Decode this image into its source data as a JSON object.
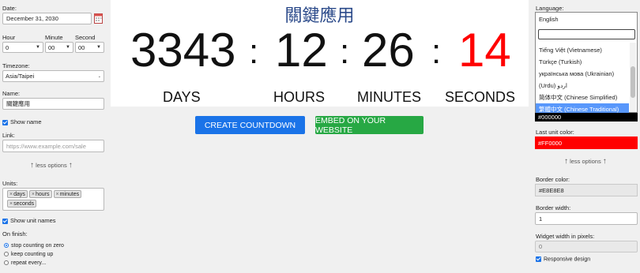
{
  "left": {
    "date_label": "Date:",
    "date_value": "December 31, 2030",
    "hour_label": "Hour",
    "hour_value": "0",
    "minute_label": "Minute",
    "minute_value": "00",
    "second_label": "Second",
    "second_value": "00",
    "timezone_label": "Timezone:",
    "timezone_value": "Asia/Taipei",
    "name_label": "Name:",
    "name_value": "關鍵應用",
    "show_name_label": "Show name",
    "link_label": "Link:",
    "link_placeholder": "https://www.example.com/sale",
    "less_options": "less options",
    "units_label": "Units:",
    "unit_tags": [
      "days",
      "hours",
      "minutes",
      "seconds"
    ],
    "show_unit_names_label": "Show unit names",
    "on_finish_label": "On finish:",
    "finish_options": [
      "stop counting on zero",
      "keep counting up",
      "repeat every..."
    ]
  },
  "center": {
    "title": "關鍵應用",
    "days": "3343",
    "hours": "12",
    "minutes": "26",
    "seconds": "14",
    "sep": ":",
    "days_label": "DAYS",
    "hours_label": "HOURS",
    "minutes_label": "MINUTES",
    "seconds_label": "SECONDS",
    "create_button": "CREATE COUNTDOWN",
    "embed_button": "EMBED ON YOUR WEBSITE"
  },
  "right": {
    "language_label": "Language:",
    "language_value": "English",
    "dropdown_search_value": "",
    "dropdown_items": [
      "Tiếng Việt (Vietnamese)",
      "Türkçe (Turkish)",
      "українська мова (Ukrainian)",
      "(Urdu) اردو",
      "简体中文 (Chinese Simplified)",
      "繁體中文 (Chinese Traditional)"
    ],
    "color_value": "#000000",
    "last_unit_color_label": "Last unit color:",
    "last_unit_color_value": "#FF0000",
    "less_options": "less options",
    "border_color_label": "Border color:",
    "border_color_value": "#E8E8E8",
    "border_width_label": "Border width:",
    "border_width_value": "1",
    "widget_width_label": "Widget width in pixels:",
    "widget_width_value": "0",
    "responsive_label": "Responsive design"
  },
  "colors": {
    "primary_button": "#1a73e8",
    "embed_button": "#27a844",
    "last_unit": "#ff0000",
    "title": "#2b4a8a"
  }
}
